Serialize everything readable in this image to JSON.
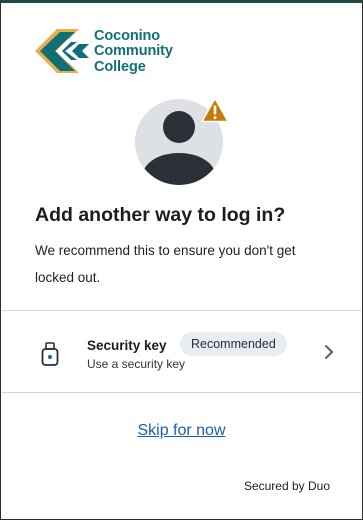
{
  "branding": {
    "logo_lines": [
      "Coconino",
      "Community",
      "College"
    ],
    "logo_color": "#0f6f76",
    "logo_accent": "#e8b04b"
  },
  "avatar": {
    "icon": "user-avatar-icon",
    "warning_icon": "warning-triangle-icon",
    "warning_color": "#c9780a"
  },
  "heading": {
    "title": "Add another way to log in?",
    "description": "We recommend this to ensure you don't get locked out."
  },
  "options": [
    {
      "icon": "security-key-icon",
      "title": "Security key",
      "badge": "Recommended",
      "subtitle": "Use a security key",
      "action_icon": "chevron-right-icon"
    }
  ],
  "actions": {
    "skip_label": "Skip for now",
    "link_color": "#1a5fb4"
  },
  "footer": {
    "secured_text": "Secured by Duo"
  }
}
